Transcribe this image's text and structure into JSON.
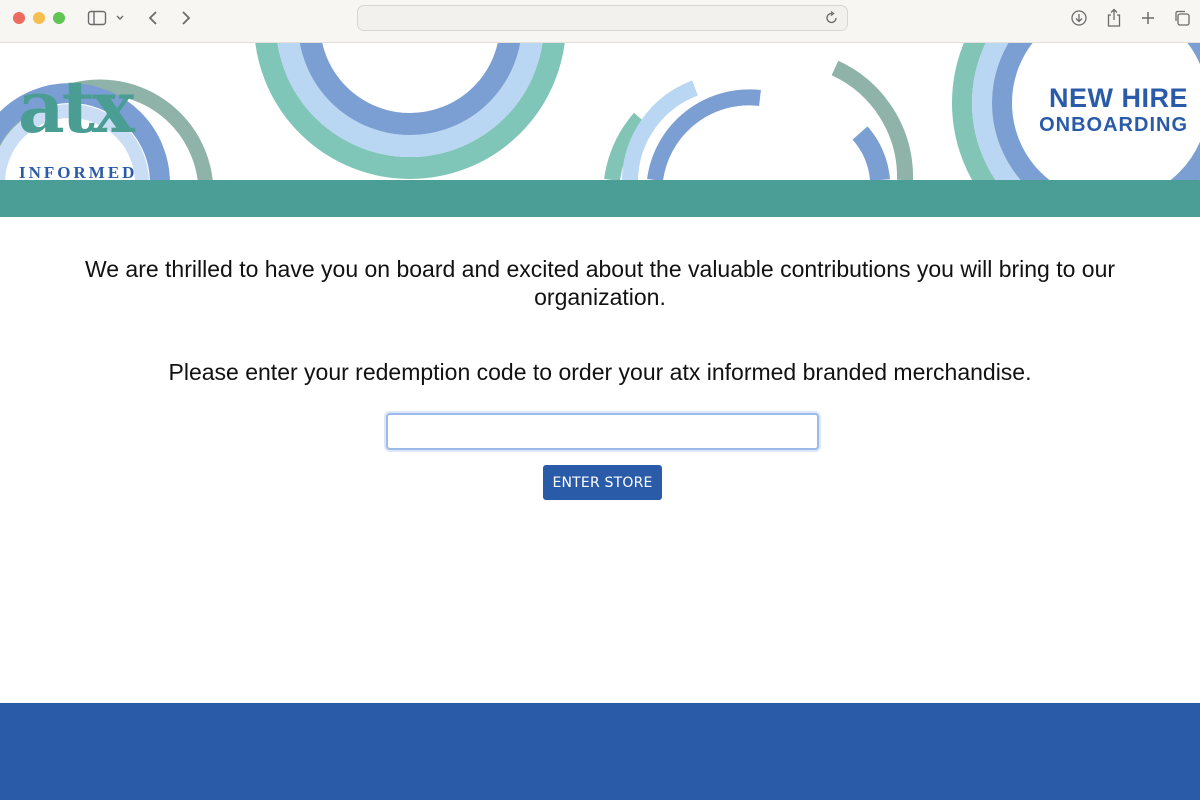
{
  "browser": {
    "url": "",
    "icons": [
      "sidebar-icon",
      "chevron-down-icon",
      "back-icon",
      "forward-icon",
      "reload-icon",
      "download-icon",
      "share-icon",
      "new-tab-icon",
      "tabs-overview-icon"
    ]
  },
  "banner": {
    "logo_main": "atx",
    "logo_sub": "INFORMED",
    "heading_line1": "NEW HIRE",
    "heading_line2": "ONBOARDING"
  },
  "main": {
    "welcome_text": "We are thrilled to have you on board and excited about the valuable contributions you will bring to our organization.",
    "prompt_text": "Please enter your redemption code to order your atx informed branded merchandise.",
    "code_input": {
      "value": "",
      "placeholder": ""
    },
    "enter_button_label": "ENTER STORE"
  },
  "colors": {
    "teal": "#4a9e96",
    "blue": "#2a5ba8",
    "light_blue": "#9dbbe8"
  }
}
